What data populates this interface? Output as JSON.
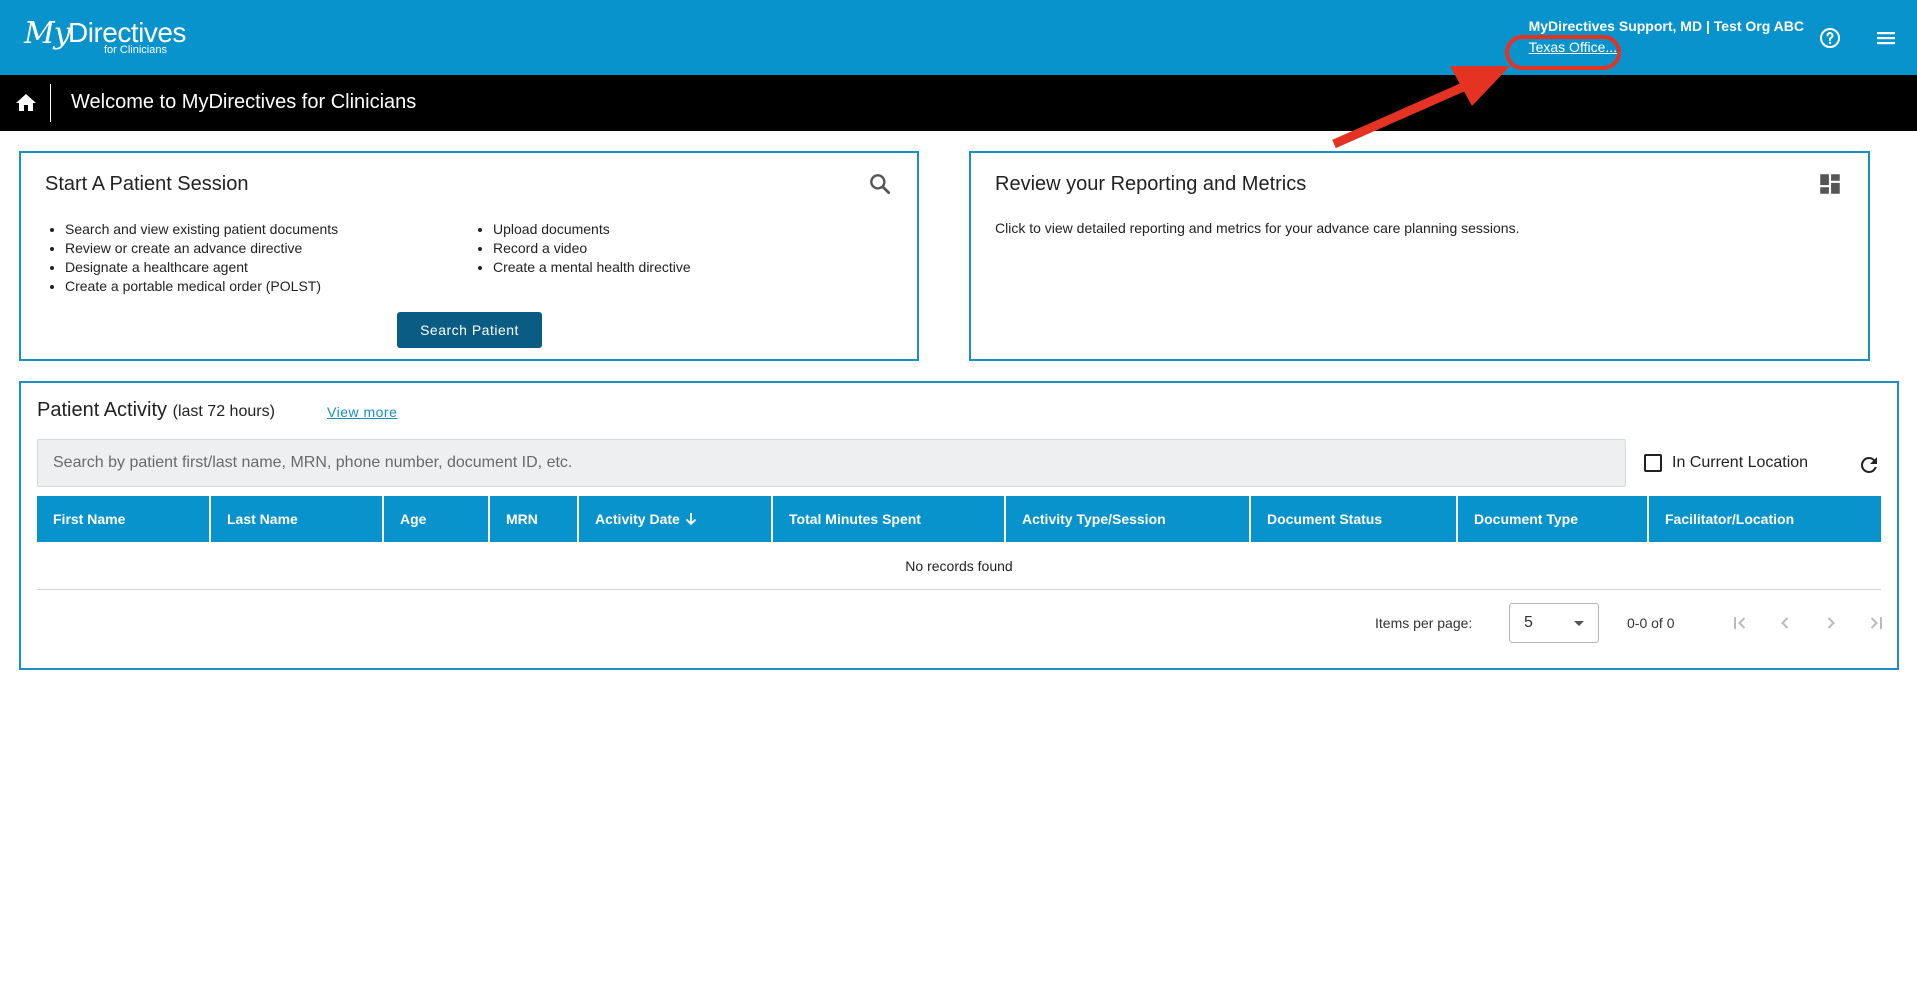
{
  "header": {
    "logo": {
      "my": "My",
      "directives": "Directives",
      "sub": "for Clinicians"
    },
    "user_name": "MyDirectives Support, MD | Test Org ABC",
    "location": "Texas Office..."
  },
  "welcome": {
    "title": "Welcome to MyDirectives for Clinicians"
  },
  "session_card": {
    "title": "Start A Patient Session",
    "left_items": [
      "Search and view existing patient documents",
      "Review or create an advance directive",
      "Designate a healthcare agent",
      "Create a portable medical order (POLST)"
    ],
    "right_items": [
      "Upload documents",
      "Record a video",
      "Create a mental health directive"
    ],
    "button_label": "Search Patient"
  },
  "metrics_card": {
    "title": "Review your Reporting and Metrics",
    "text": "Click to view detailed reporting and metrics for your advance care planning sessions."
  },
  "activity": {
    "title": "Patient Activity",
    "subtitle": "(last 72 hours)",
    "view_more": "View more",
    "search_placeholder": "Search by patient first/last name, MRN, phone number, document ID, etc.",
    "checkbox_label": "In Current Location",
    "columns": [
      "First Name",
      "Last Name",
      "Age",
      "MRN",
      "Activity Date",
      "Total Minutes Spent",
      "Activity Type/Session",
      "Document Status",
      "Document Type",
      "Facilitator/Location"
    ],
    "empty_message": "No records found",
    "items_per_page_label": "Items per page:",
    "items_per_page_value": "5",
    "range_label": "0-0 of 0"
  },
  "colors": {
    "brand_blue": "#0893cc",
    "button_dark": "#0a5c85",
    "annotation_red": "#e53323"
  }
}
